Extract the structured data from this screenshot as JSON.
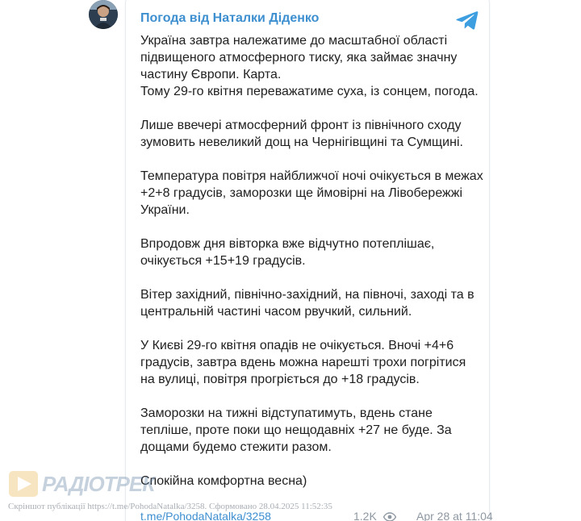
{
  "channel": {
    "name": "Погода від Наталки Діденко"
  },
  "post": {
    "paragraphs": [
      "Україна завтра належатиме до масштабної області підвищеного атмосферного тиску, яка займає значну частину Європи. Карта.\nТому 29-го квітня переважатиме суха, із сонцем, погода.",
      "Лише ввечері атмосферний фронт із північного сходу зумовить невеликий дощ на Чернігівщині та Сумщині.",
      "Температура повітря найближчої ночі очікується в межах +2+8 градусів, заморозки ще ймовірні на Лівобережжі України.",
      "Впродовж дня вівторка вже відчутно потеплішає, очікується +15+19 градусів.",
      "Вітер західний, північно-західний, на півночі, заході та в центральній частині часом рвучкий, сильний.",
      "У Києві 29-го квітня опадів не очікується. Вночі +4+6 градусів, завтра вдень можна нарешті трохи погрітися на вулиці, повітря прогріється до +18 градусів.",
      "Заморозки на тижні відступатимуть, вдень стане тепліше, проте поки що нещодавніх +27 не буде. За дощами будемо стежити разом.",
      "Спокійна комфортна весна)"
    ],
    "link": "t.me/PohodaNatalka/3258",
    "views": "1.2K",
    "date": "Apr 28 at 11:04"
  },
  "watermark": {
    "logo_text": "РАДІОТРЕК",
    "caption": "Скріншот публікації https://t.me/PohodaNatalka/3258. Сформовано 28.04.2025 11:52:35"
  },
  "icons": {
    "telegram": "telegram-icon",
    "eye": "eye-icon",
    "play": "play-icon"
  },
  "colors": {
    "accent": "#3d8fd0",
    "text": "#1f1f1f",
    "meta": "#8e98a3"
  }
}
